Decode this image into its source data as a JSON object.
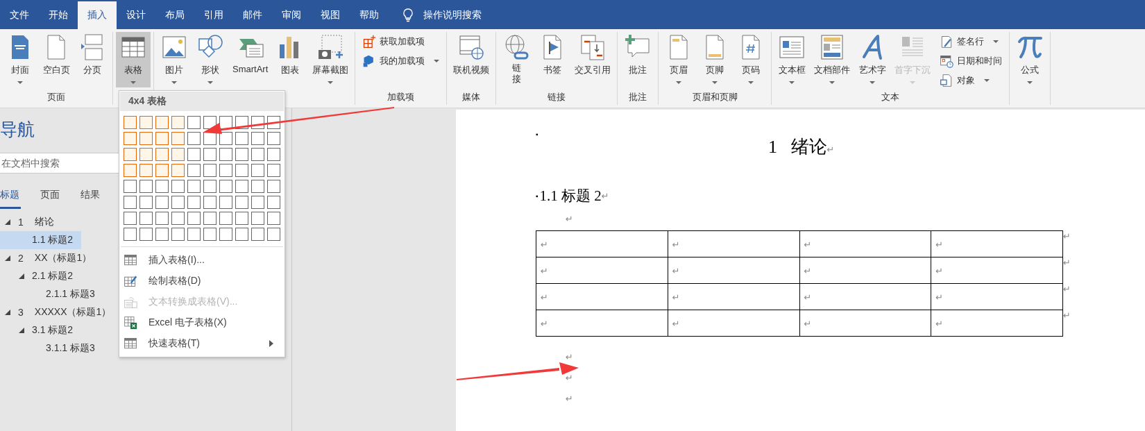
{
  "menu_tabs": [
    {
      "label": "文件",
      "selected": false
    },
    {
      "label": "开始",
      "selected": false
    },
    {
      "label": "插入",
      "selected": true
    },
    {
      "label": "设计",
      "selected": false
    },
    {
      "label": "布局",
      "selected": false
    },
    {
      "label": "引用",
      "selected": false
    },
    {
      "label": "邮件",
      "selected": false
    },
    {
      "label": "审阅",
      "selected": false
    },
    {
      "label": "视图",
      "selected": false
    },
    {
      "label": "帮助",
      "selected": false
    }
  ],
  "tell_me": "操作说明搜索",
  "ribbon": {
    "groups": [
      {
        "label": "页面",
        "items": [
          {
            "label": "封面",
            "kind": "large",
            "caret": true,
            "pressed": false,
            "disabled": false
          },
          {
            "label": "空白页",
            "kind": "large",
            "caret": false,
            "pressed": false,
            "disabled": false
          },
          {
            "label": "分页",
            "kind": "large",
            "caret": false,
            "pressed": false,
            "disabled": false
          }
        ]
      },
      {
        "items": [
          {
            "label": "表格",
            "kind": "large",
            "caret": true,
            "pressed": true,
            "disabled": false
          }
        ]
      },
      {
        "items": [
          {
            "label": "图片",
            "kind": "large",
            "caret": true,
            "pressed": false,
            "disabled": false
          },
          {
            "label": "形状",
            "kind": "large",
            "caret": true,
            "pressed": false,
            "disabled": false
          },
          {
            "label": "SmartArt",
            "kind": "large",
            "caret": false,
            "pressed": false,
            "disabled": false
          },
          {
            "label": "图表",
            "kind": "large",
            "caret": false,
            "pressed": false,
            "disabled": false
          },
          {
            "label": "屏幕截图",
            "kind": "large",
            "caret": true,
            "pressed": false,
            "disabled": false
          }
        ]
      },
      {
        "label": "加载项",
        "items": [
          {
            "label": "获取加载项",
            "kind": "small",
            "caret": false,
            "pressed": false,
            "disabled": false
          },
          {
            "label": "我的加载项",
            "kind": "small",
            "caret": true,
            "pressed": false,
            "disabled": false
          }
        ]
      },
      {
        "label": "媒体",
        "items": [
          {
            "label": "联机视频",
            "kind": "large",
            "caret": false,
            "pressed": false,
            "disabled": false
          }
        ]
      },
      {
        "label": "链接",
        "items": [
          {
            "label": "链接",
            "kind": "stacked",
            "caret": false,
            "pressed": false,
            "disabled": false
          },
          {
            "label": "书签",
            "kind": "large",
            "caret": false,
            "pressed": false,
            "disabled": false
          },
          {
            "label": "交叉引用",
            "kind": "large",
            "caret": false,
            "pressed": false,
            "disabled": false
          }
        ]
      },
      {
        "label": "批注",
        "items": [
          {
            "label": "批注",
            "kind": "large",
            "caret": false,
            "pressed": false,
            "disabled": false
          }
        ]
      },
      {
        "label": "页眉和页脚",
        "items": [
          {
            "label": "页眉",
            "kind": "large",
            "caret": true,
            "pressed": false,
            "disabled": false
          },
          {
            "label": "页脚",
            "kind": "large",
            "caret": true,
            "pressed": false,
            "disabled": false
          },
          {
            "label": "页码",
            "kind": "large",
            "caret": true,
            "pressed": false,
            "disabled": false
          }
        ]
      },
      {
        "label": "文本",
        "items": [
          {
            "label": "文本框",
            "kind": "large",
            "caret": true,
            "pressed": false,
            "disabled": false
          },
          {
            "label": "文档部件",
            "kind": "large",
            "caret": true,
            "pressed": false,
            "disabled": false
          },
          {
            "label": "艺术字",
            "kind": "large",
            "caret": true,
            "pressed": false,
            "disabled": false
          },
          {
            "label": "首字下沉",
            "kind": "large",
            "caret": true,
            "pressed": false,
            "disabled": true
          },
          {
            "label": "签名行",
            "kind": "small",
            "caret": true,
            "pressed": false,
            "disabled": false
          },
          {
            "label": "日期和时间",
            "kind": "small",
            "caret": false,
            "pressed": false,
            "disabled": false
          },
          {
            "label": "对象",
            "kind": "small",
            "caret": true,
            "pressed": false,
            "disabled": false
          }
        ]
      },
      {
        "items": [
          {
            "label": "公式",
            "kind": "large",
            "caret": true,
            "pressed": false,
            "disabled": false
          }
        ]
      }
    ]
  },
  "navigation": {
    "title": "导航",
    "search": {
      "placeholder": "在文档中搜索"
    },
    "tabs": [
      {
        "label": "标题",
        "selected": true
      },
      {
        "label": "页面",
        "selected": false
      },
      {
        "label": "结果",
        "selected": false
      }
    ],
    "tree": [
      {
        "number": "1",
        "label": "绪论",
        "expanded": true,
        "selected": false,
        "children": [
          {
            "label": "1.1 标题2",
            "selected": true
          }
        ]
      },
      {
        "number": "2",
        "label": "XX（标题1）",
        "expanded": true,
        "selected": false,
        "children": [
          {
            "label": "2.1 标题2",
            "expanded": true,
            "selected": false,
            "children": [
              {
                "label": "2.1.1 标题3",
                "selected": false
              }
            ]
          }
        ]
      },
      {
        "number": "3",
        "label": "XXXXX（标题1）",
        "expanded": true,
        "selected": false,
        "children": [
          {
            "label": "3.1 标题2",
            "expanded": true,
            "selected": false,
            "children": [
              {
                "label": "3.1.1 标题3",
                "selected": false
              }
            ]
          }
        ]
      }
    ]
  },
  "table_menu": {
    "header": "4x4 表格",
    "grid": [
      {
        "highlighted": [
          true,
          true,
          true,
          true,
          false,
          false,
          false,
          false,
          false,
          false
        ]
      },
      {
        "highlighted": [
          true,
          true,
          true,
          true,
          false,
          false,
          false,
          false,
          false,
          false
        ]
      },
      {
        "highlighted": [
          true,
          true,
          true,
          true,
          false,
          false,
          false,
          false,
          false,
          false
        ]
      },
      {
        "highlighted": [
          true,
          true,
          true,
          true,
          false,
          false,
          false,
          false,
          false,
          false
        ]
      },
      {
        "highlighted": [
          false,
          false,
          false,
          false,
          false,
          false,
          false,
          false,
          false,
          false
        ]
      },
      {
        "highlighted": [
          false,
          false,
          false,
          false,
          false,
          false,
          false,
          false,
          false,
          false
        ]
      },
      {
        "highlighted": [
          false,
          false,
          false,
          false,
          false,
          false,
          false,
          false,
          false,
          false
        ]
      },
      {
        "highlighted": [
          false,
          false,
          false,
          false,
          false,
          false,
          false,
          false,
          false,
          false
        ]
      }
    ],
    "items": [
      {
        "label": "插入表格(I)...",
        "disabled": false,
        "submenu": false
      },
      {
        "label": "绘制表格(D)",
        "disabled": false,
        "submenu": false
      },
      {
        "label": "文本转换成表格(V)...",
        "disabled": true,
        "submenu": false
      },
      {
        "label": "Excel 电子表格(X)",
        "disabled": false,
        "submenu": false
      },
      {
        "label": "快速表格(T)",
        "disabled": false,
        "submenu": true
      }
    ]
  },
  "document": {
    "blocks": [
      {
        "kind": "heading1",
        "bullet": "▪",
        "text": "1   绪论",
        "mark": "↵"
      },
      {
        "kind": "heading2",
        "bullet": "▪",
        "text": "1.1 标题 2",
        "mark": "↵"
      },
      {
        "kind": "empty",
        "mark": "↵"
      },
      {
        "kind": "table",
        "rows": [
          {
            "cells": [
              "↵",
              "↵",
              "↵",
              "↵"
            ],
            "end_mark": "↵"
          },
          {
            "cells": [
              "↵",
              "↵",
              "↵",
              "↵"
            ],
            "end_mark": "↵"
          },
          {
            "cells": [
              "↵",
              "↵",
              "↵",
              "↵"
            ],
            "end_mark": "↵"
          },
          {
            "cells": [
              "↵",
              "↵",
              "↵",
              "↵"
            ],
            "end_mark": "↵"
          }
        ]
      },
      {
        "kind": "empty",
        "mark": "↵"
      },
      {
        "kind": "empty",
        "mark": "↵"
      },
      {
        "kind": "empty",
        "mark": "↵"
      }
    ]
  }
}
